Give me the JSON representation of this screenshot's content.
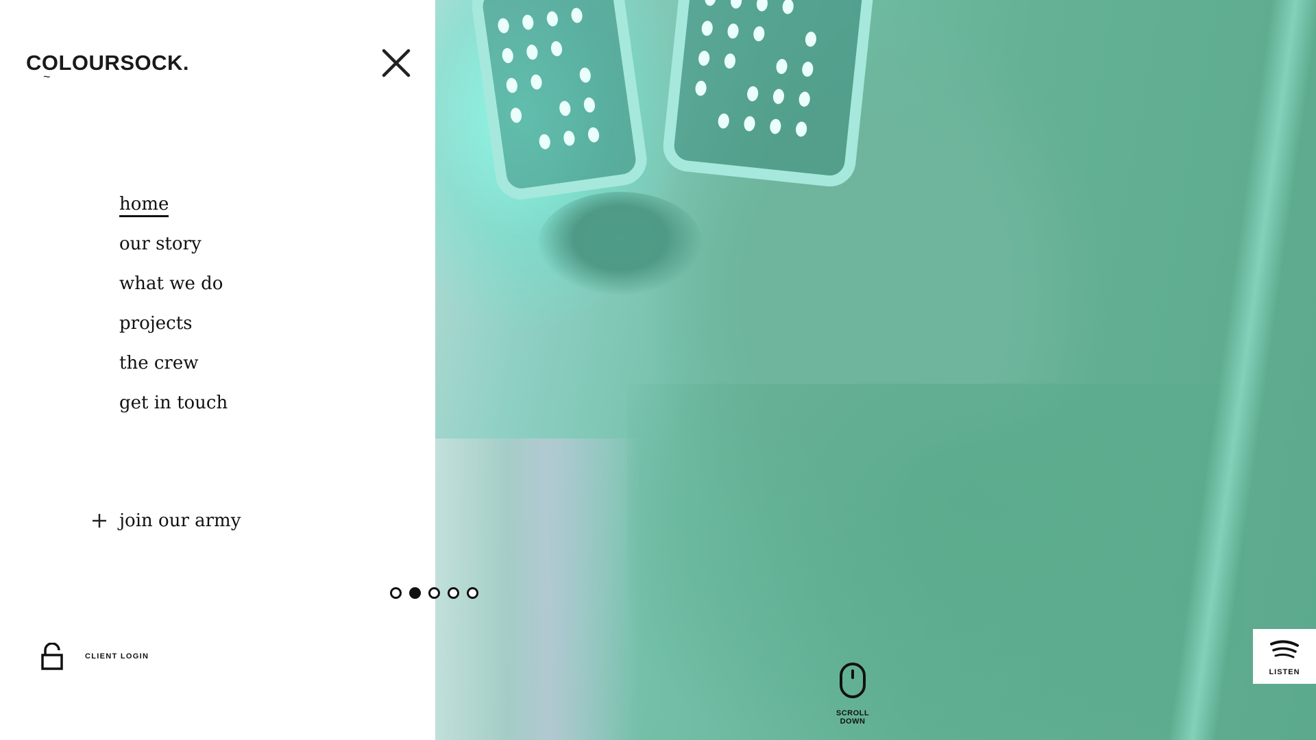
{
  "brand": {
    "logo_text": "COLOURSOCK.",
    "logo_tilde": "~"
  },
  "menu": {
    "items": [
      {
        "label": "home",
        "active": true
      },
      {
        "label": "our story"
      },
      {
        "label": "what we do"
      },
      {
        "label": "projects"
      },
      {
        "label": "the crew"
      },
      {
        "label": "get in touch"
      }
    ],
    "close_icon": "close-icon"
  },
  "join": {
    "label": "join our army",
    "icon": "plus-icon"
  },
  "client_login": {
    "label": "CLIENT LOGIN",
    "icon": "unlock-icon"
  },
  "pagination": {
    "count": 5,
    "active_index": 1
  },
  "scroll": {
    "label": "SCROLL DOWN",
    "icon": "mouse-icon"
  },
  "listen": {
    "label": "LISTEN",
    "icon": "spotify-icon"
  },
  "colors": {
    "panel_bg": "#ffffff",
    "text": "#111111",
    "hero_tint": "#6fb59d"
  }
}
